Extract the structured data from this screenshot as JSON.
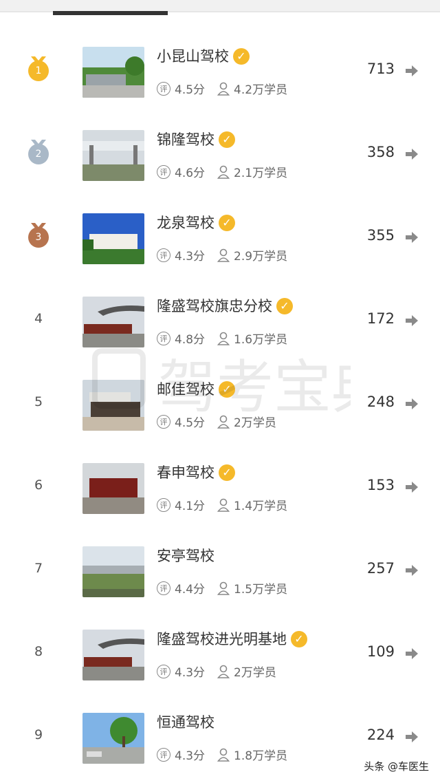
{
  "header": {
    "tab_indicator": "active-tab-indicator"
  },
  "colors": {
    "gold": "#f5b92a",
    "silver": "#a9b8c7",
    "bronze": "#b7744f",
    "verified": "#f5b92a"
  },
  "schools": [
    {
      "rank": "1",
      "medal": "gold",
      "name": "小昆山驾校",
      "verified": true,
      "rating": "4.5分",
      "students": "4.2万学员",
      "count": "713"
    },
    {
      "rank": "2",
      "medal": "silver",
      "name": "锦隆驾校",
      "verified": true,
      "rating": "4.6分",
      "students": "2.1万学员",
      "count": "358"
    },
    {
      "rank": "3",
      "medal": "bronze",
      "name": "龙泉驾校",
      "verified": true,
      "rating": "4.3分",
      "students": "2.9万学员",
      "count": "355"
    },
    {
      "rank": "4",
      "medal": "",
      "name": "隆盛驾校旗忠分校",
      "verified": true,
      "rating": "4.8分",
      "students": "1.6万学员",
      "count": "172"
    },
    {
      "rank": "5",
      "medal": "",
      "name": "邮佳驾校",
      "verified": true,
      "rating": "4.5分",
      "students": "2万学员",
      "count": "248"
    },
    {
      "rank": "6",
      "medal": "",
      "name": "春申驾校",
      "verified": true,
      "rating": "4.1分",
      "students": "1.4万学员",
      "count": "153"
    },
    {
      "rank": "7",
      "medal": "",
      "name": "安亭驾校",
      "verified": false,
      "rating": "4.4分",
      "students": "1.5万学员",
      "count": "257"
    },
    {
      "rank": "8",
      "medal": "",
      "name": "隆盛驾校进光明基地",
      "verified": true,
      "rating": "4.3分",
      "students": "2万学员",
      "count": "109"
    },
    {
      "rank": "9",
      "medal": "",
      "name": "恒通驾校",
      "verified": false,
      "rating": "4.3分",
      "students": "1.8万学员",
      "count": "224"
    }
  ],
  "labels": {
    "rate_badge": "评",
    "verified_glyph": "✓"
  },
  "watermark": "驾考宝典",
  "footer_watermark": "头条 @车医生"
}
